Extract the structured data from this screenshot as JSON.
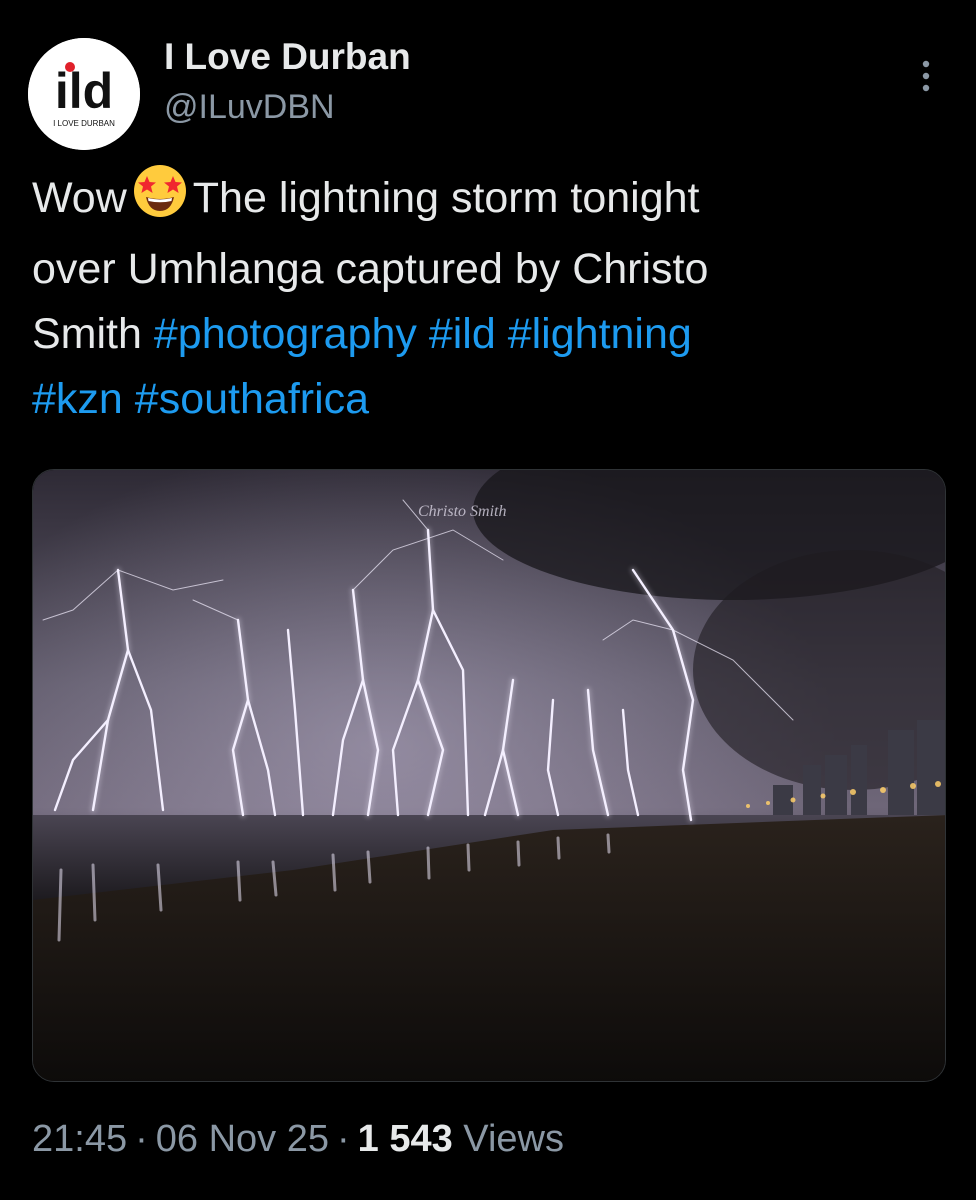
{
  "account": {
    "display_name": "I Love Durban",
    "handle": "@ILuvDBN",
    "avatar_logo_text": "ild",
    "avatar_sub_text": "I LOVE DURBAN",
    "avatar_icon": "ild-logo"
  },
  "more_icon": "more-vertical-icon",
  "tweet": {
    "line1_prefix": "Wow",
    "line1_emoji": "star-struck-emoji",
    "line1_suffix": "The lightning storm tonight",
    "line2": "over Umhlanga captured by Christo",
    "line3_text": "Smith",
    "hashtags": [
      "#photography",
      "#ild",
      "#lightning",
      "#kzn",
      "#southafrica"
    ]
  },
  "media": {
    "watermark": "Christo Smith",
    "subject": "night-lightning-over-beach-photo"
  },
  "meta": {
    "time": "21:45",
    "date": "06 Nov 25",
    "views_count": "1 543",
    "views_label": "Views",
    "separator": "·"
  },
  "colors": {
    "background": "#000000",
    "primary_text": "#e7e9ea",
    "secondary_text": "#8b98a5",
    "link": "#1d9bf0",
    "brand_red": "#e0202a"
  }
}
